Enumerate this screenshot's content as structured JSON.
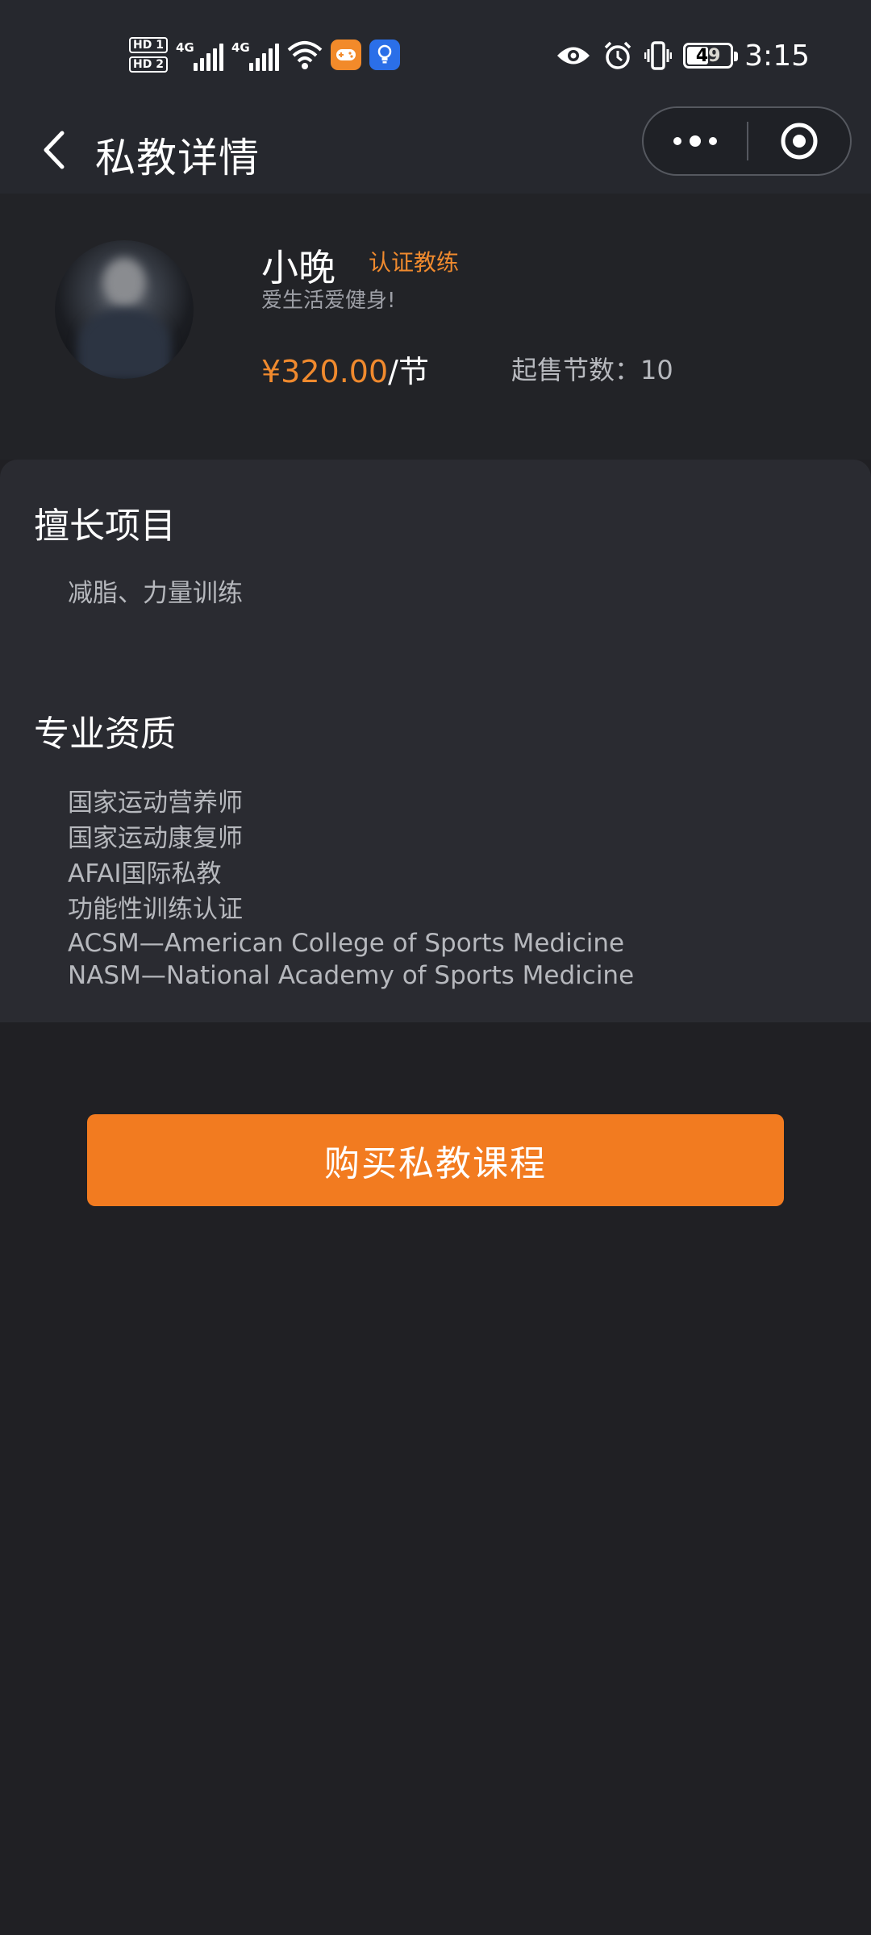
{
  "status_bar": {
    "sim1": "HD 1",
    "sim2": "HD 2",
    "network1": "4G",
    "network2": "4G",
    "battery": "49",
    "time": "3:15"
  },
  "nav": {
    "title": "私教详情"
  },
  "coach": {
    "name": "小晚",
    "badge": "认证教练",
    "motto": "爱生活爱健身!",
    "price": "¥320.00",
    "price_unit": "/节",
    "min_sessions": "起售节数：10"
  },
  "specialty": {
    "title": "擅长项目",
    "text": "减脂、力量训练"
  },
  "qualifications": {
    "title": "专业资质",
    "items": [
      "国家运动营养师",
      "国家运动康复师",
      "AFAI国际私教",
      "功能性训练认证",
      "ACSM—American College of Sports Medicine",
      "NASM—National Academy of Sports Medicine"
    ]
  },
  "buy_button": {
    "label": "购买私教课程"
  },
  "colors": {
    "accent": "#f27b20",
    "background": "#202024",
    "card": "#2a2b31"
  }
}
